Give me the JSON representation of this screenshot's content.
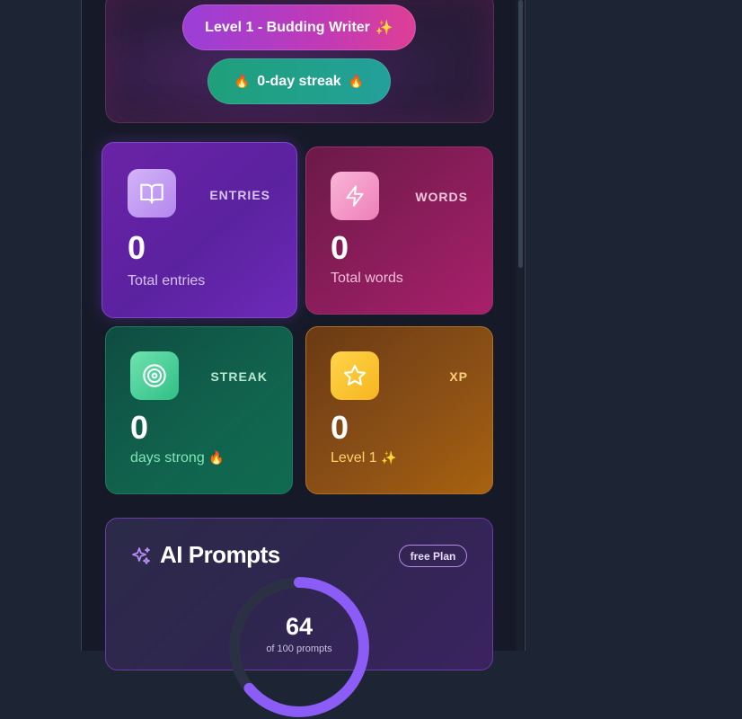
{
  "header": {
    "level_label": "Level 1 - Budding Writer",
    "level_emoji": "✨",
    "streak_label": "0-day streak",
    "streak_emoji": "🔥"
  },
  "stats": {
    "entries": {
      "tag": "ENTRIES",
      "value": "0",
      "label": "Total entries",
      "icon": "book-open-icon"
    },
    "words": {
      "tag": "WORDS",
      "value": "0",
      "label": "Total words",
      "icon": "lightning-icon"
    },
    "streak": {
      "tag": "STREAK",
      "value": "0",
      "label": "days strong",
      "label_emoji": "🔥",
      "icon": "target-icon"
    },
    "xp": {
      "tag": "XP",
      "value": "0",
      "label": "Level 1",
      "label_emoji": "✨",
      "icon": "star-icon"
    }
  },
  "ai_prompts": {
    "title": "AI Prompts",
    "plan_badge": "free Plan",
    "remaining_value": "64",
    "remaining_sub": "of 100 prompts",
    "remaining_fraction": 0.64,
    "icon": "sparkles-icon"
  },
  "colors": {
    "page_bg": "#1d2433",
    "panel_bg": "#161a28",
    "entries_accent": "#c9a8f5",
    "words_accent": "#f3a6cf",
    "streak_accent": "#5fe0a4",
    "xp_accent": "#ffd54a",
    "ring_accent": "#8b5cf6"
  }
}
